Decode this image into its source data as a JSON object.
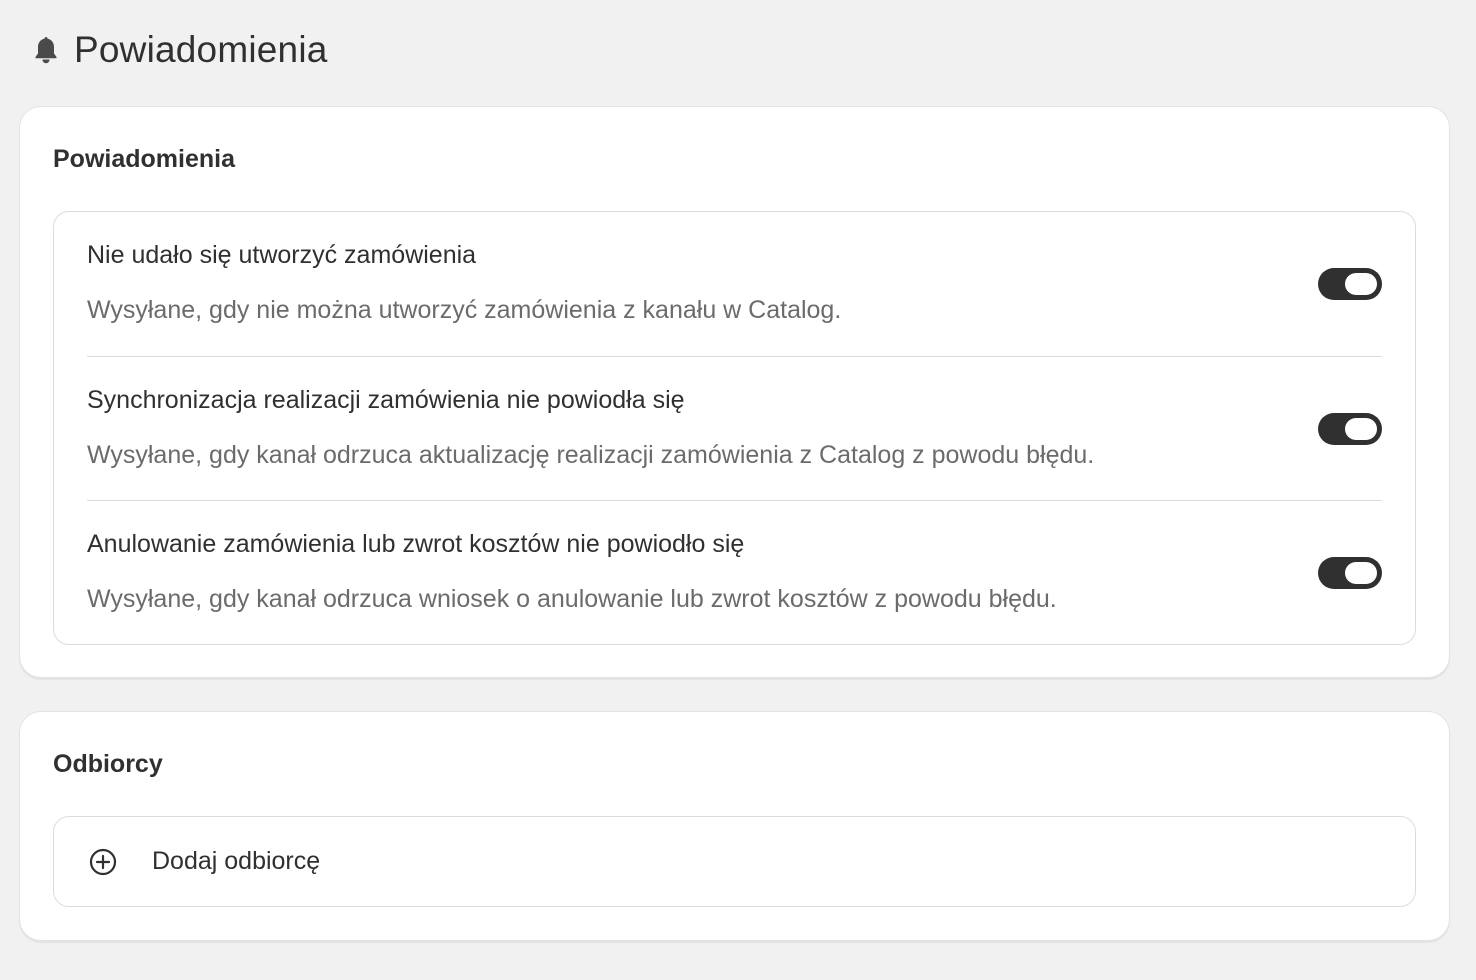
{
  "header": {
    "icon": "bell-icon",
    "title": "Powiadomienia"
  },
  "notifications": {
    "title": "Powiadomienia",
    "items": [
      {
        "title": "Nie udało się utworzyć zamówienia",
        "description": "Wysyłane, gdy nie można utworzyć zamówienia z kanału w Catalog.",
        "enabled": true
      },
      {
        "title": "Synchronizacja realizacji zamówienia nie powiodła się",
        "description": "Wysyłane, gdy kanał odrzuca aktualizację realizacji zamówienia z Catalog z powodu błędu.",
        "enabled": true
      },
      {
        "title": "Anulowanie zamówienia lub zwrot kosztów nie powiodło się",
        "description": "Wysyłane, gdy kanał odrzuca wniosek o anulowanie lub zwrot kosztów z powodu błędu.",
        "enabled": true
      }
    ]
  },
  "recipients": {
    "title": "Odbiorcy",
    "add_icon": "plus-circle-icon",
    "add_label": "Dodaj odbiorcę"
  },
  "colors": {
    "background": "#f1f1f1",
    "card": "#ffffff",
    "toggle_on": "#303030",
    "text_primary": "#303030",
    "text_secondary": "#6b6b6b"
  }
}
